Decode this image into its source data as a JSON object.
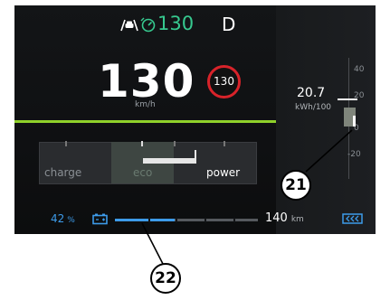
{
  "top": {
    "assist_speed": "130",
    "gear": "D"
  },
  "speed": {
    "value": "130",
    "unit": "km/h"
  },
  "speed_limit": "130",
  "consumption": {
    "value": "20.7",
    "unit": "kWh/100",
    "scale_ticks": [
      "40",
      "20",
      "0",
      "-20"
    ]
  },
  "power_gauge": {
    "left_label": "charge",
    "mid_label": "eco",
    "right_label": "power"
  },
  "battery": {
    "percent": "42",
    "percent_unit": "%",
    "level_fraction": 0.42,
    "range": "140",
    "range_unit": "km"
  },
  "callouts": {
    "consumption_marker": "21",
    "battery_bar": "22"
  },
  "colors": {
    "accent_green": "#36c98f",
    "eco_line": "#8fd12a",
    "limit_red": "#d8232a",
    "battery_blue": "#3d9be9"
  },
  "icons": [
    "car-lane-assist-icon",
    "speed-limiter-icon",
    "battery-icon",
    "regen-charge-icon"
  ]
}
